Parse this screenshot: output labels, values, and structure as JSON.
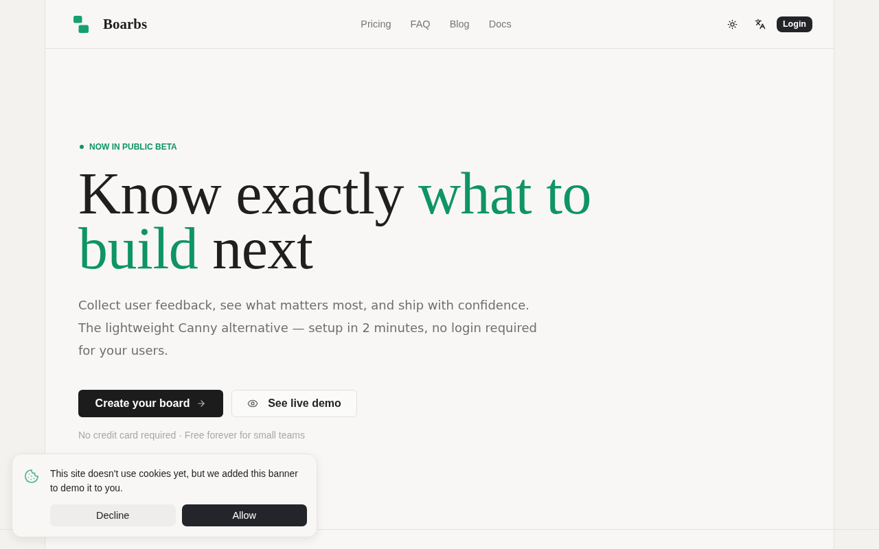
{
  "header": {
    "brand": "Boarbs",
    "nav": [
      "Pricing",
      "FAQ",
      "Blog",
      "Docs"
    ],
    "login_button": "Login"
  },
  "hero": {
    "badge": "NOW IN PUBLIC BETA",
    "headline": [
      {
        "text": "Know exactly",
        "accent": false
      },
      {
        "text": "what to build",
        "accent": true
      },
      {
        "text": "next",
        "accent": false
      }
    ],
    "subtitle": "Collect user feedback, see what matters most, and ship with confidence. The lightweight Canny alternative — setup in 2 minutes, no login required for your users.",
    "primary_button": "Create your board",
    "secondary_button": "See live demo",
    "note": "No credit card required · Free forever for small teams"
  },
  "cookie_banner": {
    "message": "This site doesn't use cookies yet, but we added this banner to demo it to you.",
    "buttons": [
      {
        "label": "Decline",
        "kind": "secondary"
      },
      {
        "label": "Allow",
        "kind": "primary"
      }
    ]
  }
}
